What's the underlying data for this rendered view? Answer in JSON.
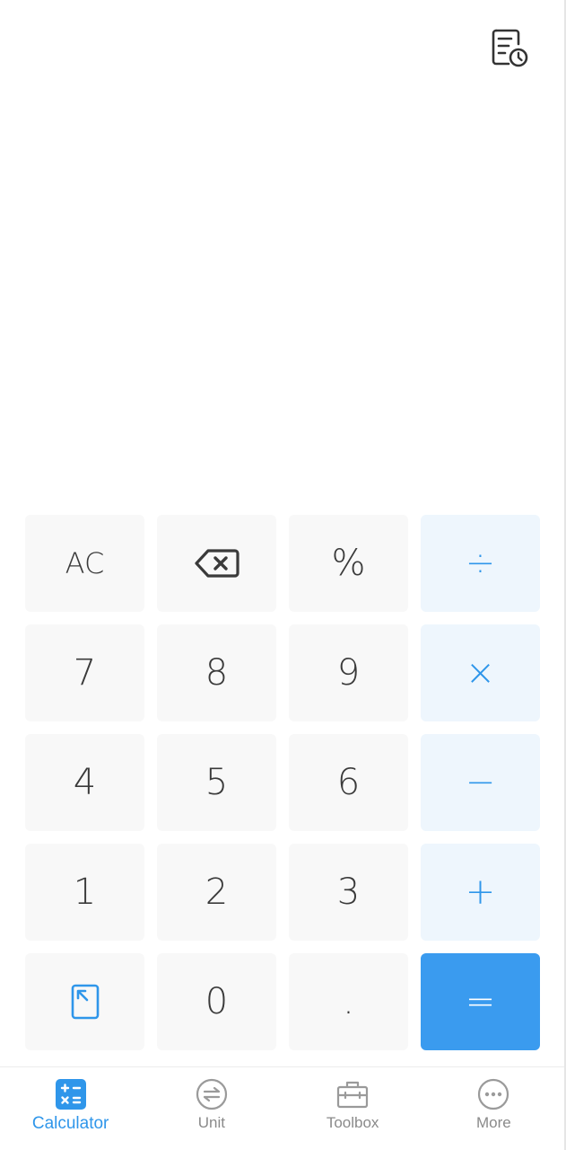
{
  "keypad": {
    "ac": "AC",
    "percent": "%",
    "digits": [
      "7",
      "8",
      "9",
      "4",
      "5",
      "6",
      "1",
      "2",
      "3",
      "0"
    ],
    "decimal": ".",
    "divide": "÷",
    "multiply": "×",
    "subtract": "−",
    "add": "+",
    "equals": "="
  },
  "tabs": [
    {
      "label": "Calculator",
      "icon": "calculator-icon",
      "active": true
    },
    {
      "label": "Unit",
      "icon": "unit-exchange-icon",
      "active": false
    },
    {
      "label": "Toolbox",
      "icon": "toolbox-icon",
      "active": false
    },
    {
      "label": "More",
      "icon": "more-dots-icon",
      "active": false
    }
  ],
  "colors": {
    "accent": "#2f96ea",
    "equals_bg": "#3a9bef",
    "operator_bg": "#eef6fd",
    "key_bg": "#f8f8f8",
    "digit_text": "#3a3a3a",
    "inactive_tab": "#8a8a8a"
  }
}
